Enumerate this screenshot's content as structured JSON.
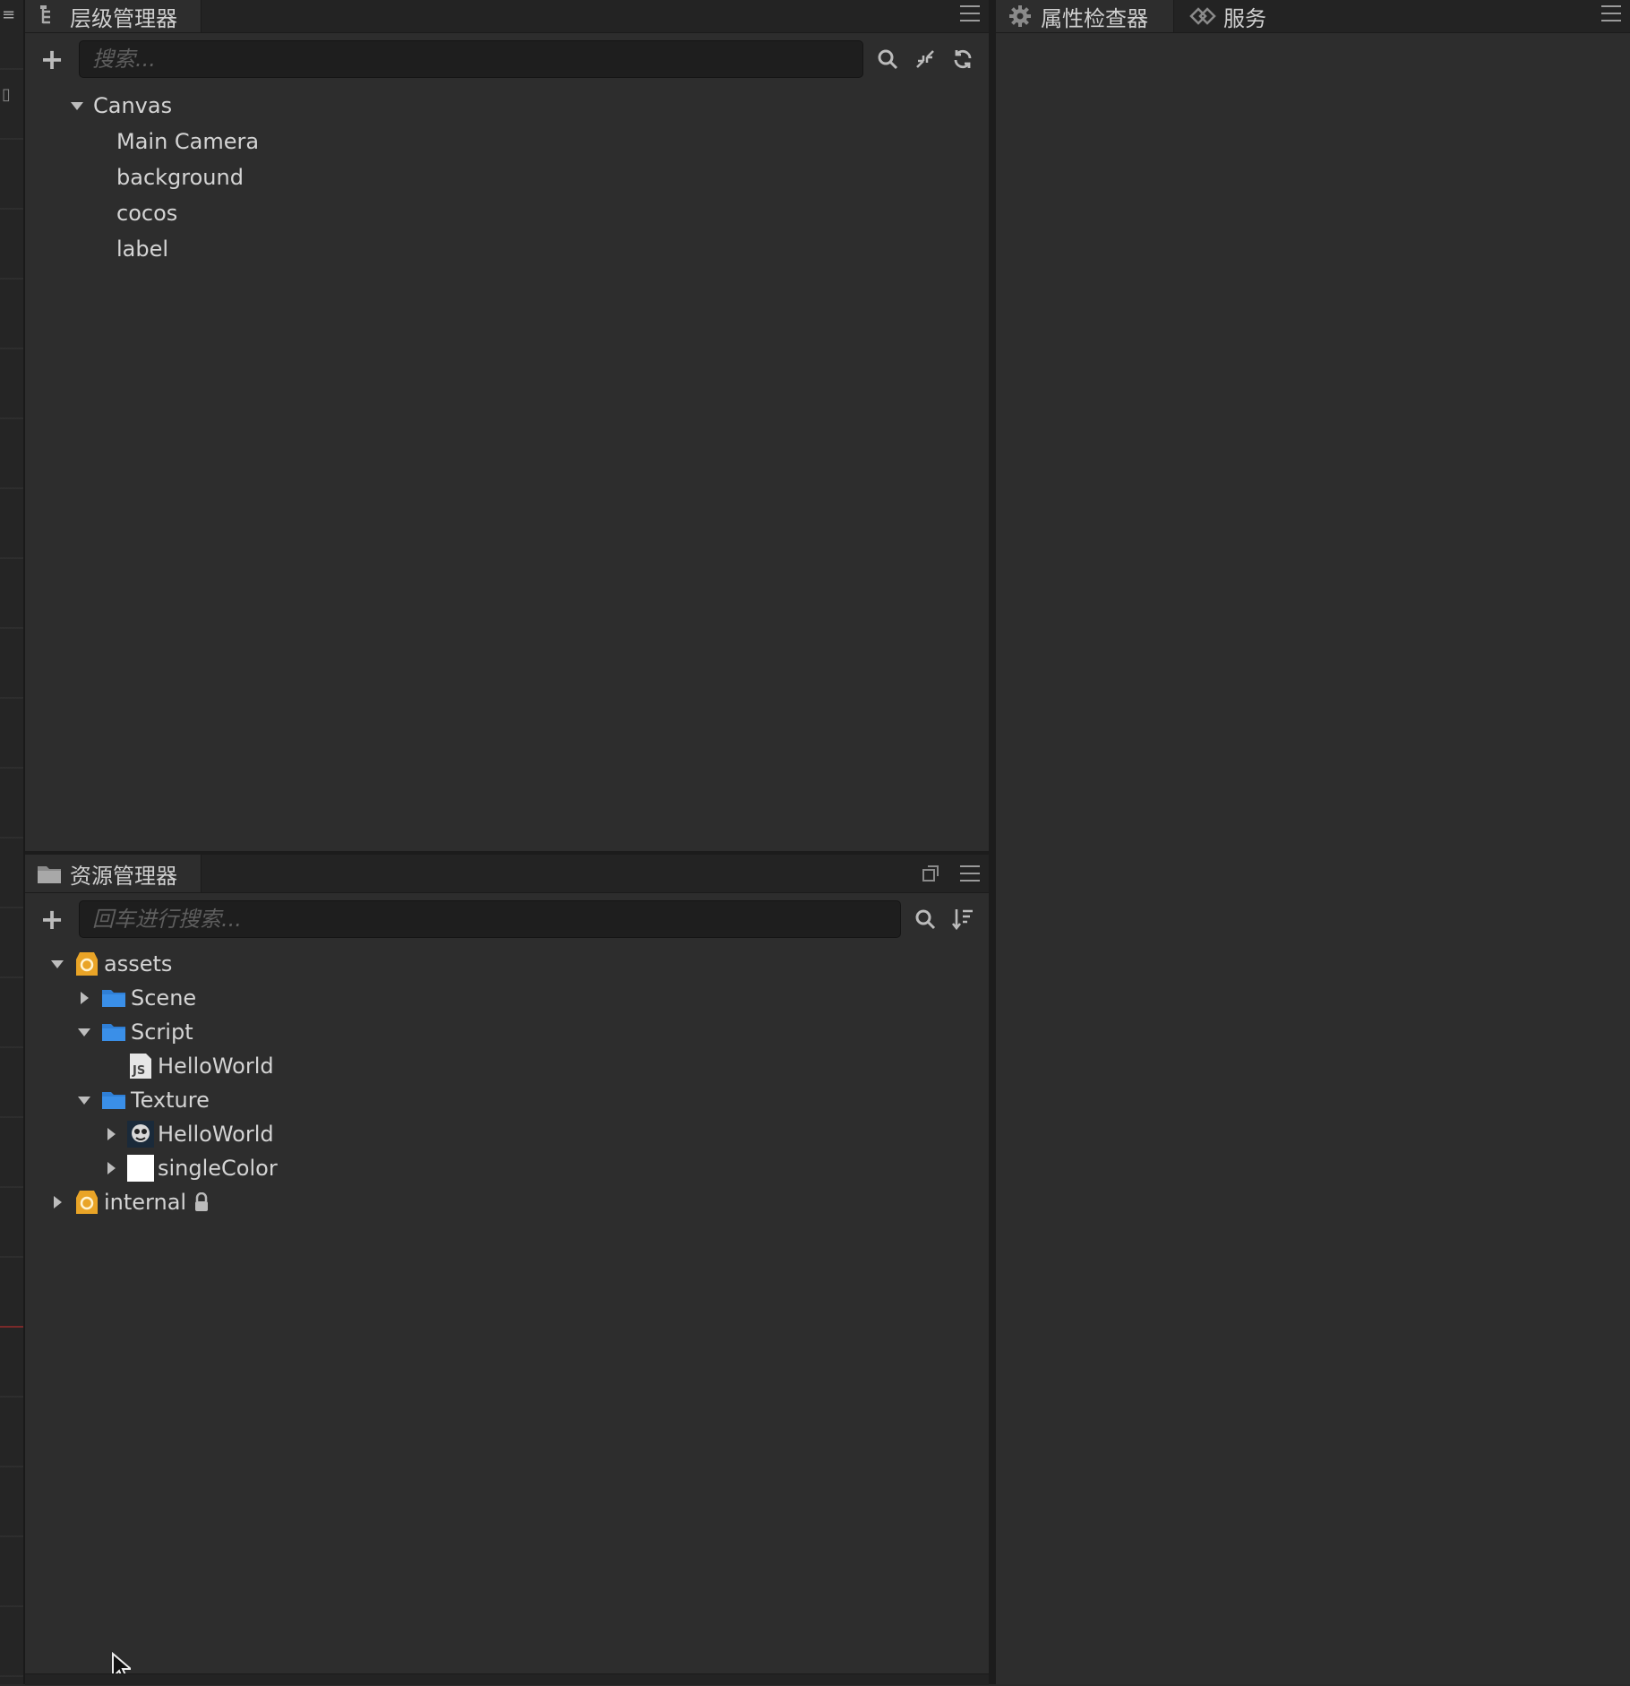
{
  "hierarchy_panel": {
    "tab_label": "层级管理器",
    "tab_icon": "hierarchy-icon",
    "search_placeholder": "搜索...",
    "nodes": [
      {
        "label": "Canvas",
        "expanded": true
      },
      {
        "label": "Main Camera"
      },
      {
        "label": "background"
      },
      {
        "label": "cocos"
      },
      {
        "label": "label"
      }
    ]
  },
  "inspector_panel": {
    "tabs": [
      {
        "label": "属性检查器",
        "icon": "gear-icon"
      },
      {
        "label": "服务",
        "icon": "service-icon"
      }
    ]
  },
  "assets_panel": {
    "tab_label": "资源管理器",
    "tab_icon": "folder-icon",
    "search_placeholder": "回车进行搜索...",
    "items": [
      {
        "label": "assets",
        "icon": "database-icon",
        "expanded": true
      },
      {
        "label": "Scene",
        "icon": "folder-icon",
        "expanded": false
      },
      {
        "label": "Script",
        "icon": "folder-icon",
        "expanded": true
      },
      {
        "label": "HelloWorld",
        "icon": "js-file-icon"
      },
      {
        "label": "Texture",
        "icon": "folder-icon",
        "expanded": true
      },
      {
        "label": "HelloWorld",
        "icon": "image-thumbnail-icon",
        "expanded": false
      },
      {
        "label": "singleColor",
        "icon": "white-texture-icon",
        "expanded": false
      },
      {
        "label": "internal",
        "icon": "database-icon",
        "expanded": false,
        "locked": true
      }
    ]
  },
  "colors": {
    "panel_bg": "#2d2d2d",
    "tabbar_bg": "#232323",
    "folder_blue": "#3a8fe8",
    "db_orange": "#e9a427"
  }
}
